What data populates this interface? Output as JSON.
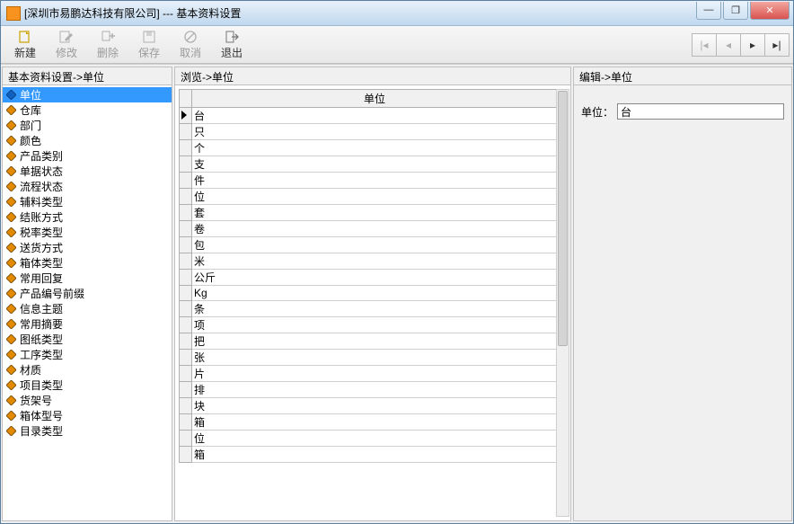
{
  "window": {
    "title": "[深圳市易鹏达科技有限公司] --- 基本资料设置"
  },
  "toolbar": {
    "new": "新建",
    "modify": "修改",
    "delete": "删除",
    "save": "保存",
    "cancel": "取消",
    "exit": "退出"
  },
  "panels": {
    "left_header": "基本资料设置->单位",
    "mid_header": "浏览->单位",
    "right_header": "编辑->单位"
  },
  "tree": {
    "items": [
      "单位",
      "仓库",
      "部门",
      "颜色",
      "产品类别",
      "单据状态",
      "流程状态",
      "辅料类型",
      "结账方式",
      "税率类型",
      "送货方式",
      "箱体类型",
      "常用回复",
      "产品编号前缀",
      "信息主题",
      "常用摘要",
      "图纸类型",
      "工序类型",
      "材质",
      "项目类型",
      "货架号",
      "箱体型号",
      "目录类型"
    ],
    "selected_index": 0
  },
  "grid": {
    "column_header": "单位",
    "rows": [
      "台",
      "只",
      "个",
      "支",
      "件",
      "位",
      "套",
      "卷",
      "包",
      "米",
      "公斤",
      "Kg",
      "条",
      "项",
      "把",
      "张",
      "片",
      "排",
      "块",
      "箱",
      "位",
      "箱"
    ],
    "current_row_index": 0
  },
  "edit": {
    "label": "单位：",
    "value": "台"
  },
  "nav": {
    "first": "|◂",
    "prev": "◂",
    "next": "▸",
    "last": "▸|"
  },
  "winctrl": {
    "min": "—",
    "max": "❐",
    "close": "✕"
  },
  "chart_data": {
    "type": "table",
    "title": "单位",
    "columns": [
      "单位"
    ],
    "rows": [
      [
        "台"
      ],
      [
        "只"
      ],
      [
        "个"
      ],
      [
        "支"
      ],
      [
        "件"
      ],
      [
        "位"
      ],
      [
        "套"
      ],
      [
        "卷"
      ],
      [
        "包"
      ],
      [
        "米"
      ],
      [
        "公斤"
      ],
      [
        "Kg"
      ],
      [
        "条"
      ],
      [
        "项"
      ],
      [
        "把"
      ],
      [
        "张"
      ],
      [
        "片"
      ],
      [
        "排"
      ],
      [
        "块"
      ],
      [
        "箱"
      ],
      [
        "位"
      ],
      [
        "箱"
      ]
    ]
  }
}
